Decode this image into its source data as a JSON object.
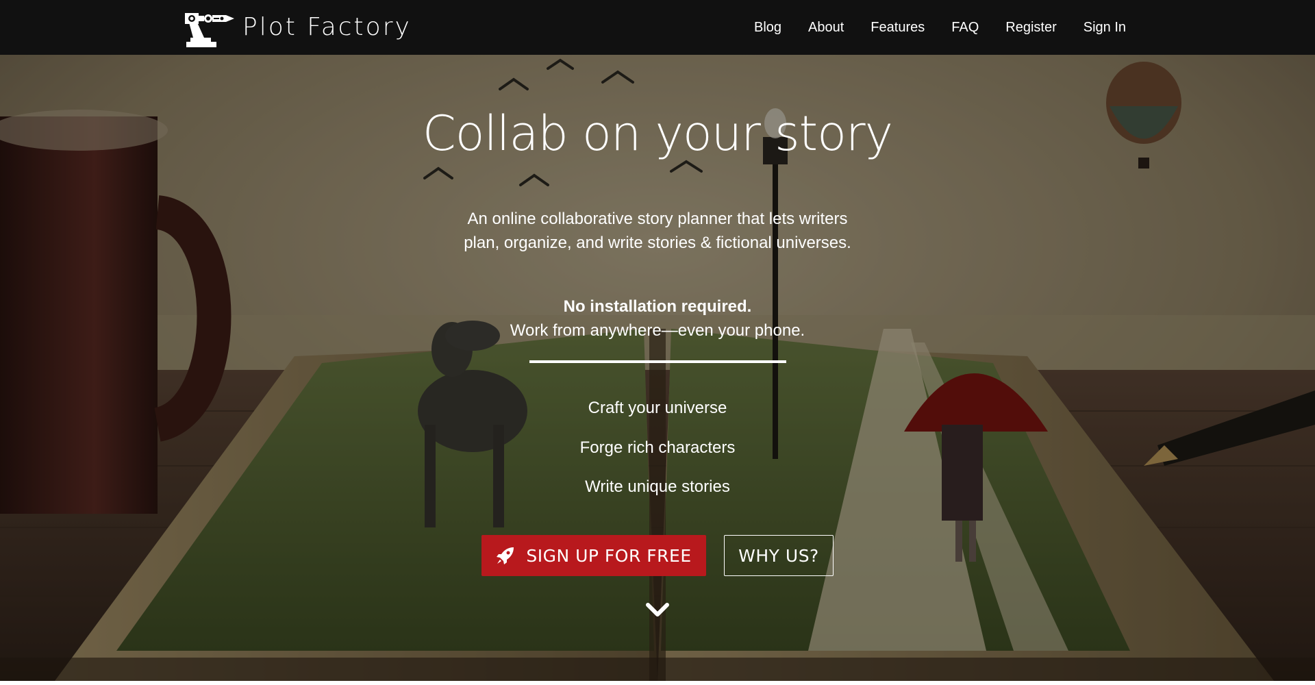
{
  "nav": {
    "brand": "Plot Factory",
    "logo_icon": "robot-arm-pen-icon",
    "links": [
      "Blog",
      "About",
      "Features",
      "FAQ",
      "Register",
      "Sign In"
    ]
  },
  "hero": {
    "title": "Collab on your story",
    "description": "An online collaborative story planner that lets writers plan, organize, and write stories & fictional universes.",
    "strong": "No installation required.",
    "sub": "Work from anywhere—even your phone.",
    "features": [
      "Craft your universe",
      "Forge rich characters",
      "Write unique stories"
    ],
    "signup_label": "SIGN UP FOR FREE",
    "signup_icon": "rocket-icon",
    "why_label": "WHY US?",
    "scroll_icon": "chevron-down-icon"
  },
  "colors": {
    "nav_bg": "#111111",
    "accent_red": "#b8191d",
    "text": "#ffffff"
  }
}
